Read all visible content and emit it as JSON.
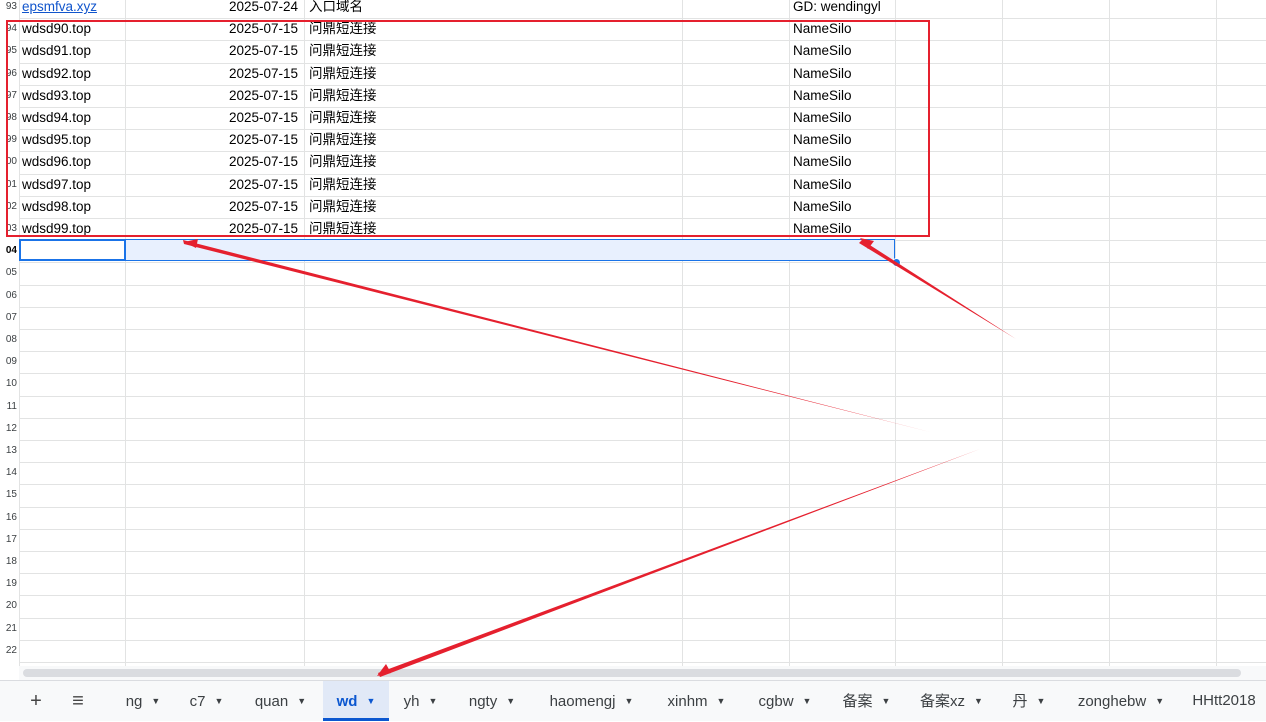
{
  "rows": [
    {
      "num": "93",
      "domain": "epsmfva.xyz",
      "date": "2025-07-24",
      "desc": "入口域名",
      "registrar": "GD: wendingyl",
      "link": true
    },
    {
      "num": "94",
      "domain": "wdsd90.top",
      "date": "2025-07-15",
      "desc": "问鼎短连接",
      "registrar": "NameSilo"
    },
    {
      "num": "95",
      "domain": "wdsd91.top",
      "date": "2025-07-15",
      "desc": "问鼎短连接",
      "registrar": "NameSilo"
    },
    {
      "num": "96",
      "domain": "wdsd92.top",
      "date": "2025-07-15",
      "desc": "问鼎短连接",
      "registrar": "NameSilo"
    },
    {
      "num": "97",
      "domain": "wdsd93.top",
      "date": "2025-07-15",
      "desc": "问鼎短连接",
      "registrar": "NameSilo"
    },
    {
      "num": "98",
      "domain": "wdsd94.top",
      "date": "2025-07-15",
      "desc": "问鼎短连接",
      "registrar": "NameSilo"
    },
    {
      "num": "99",
      "domain": "wdsd95.top",
      "date": "2025-07-15",
      "desc": "问鼎短连接",
      "registrar": "NameSilo"
    },
    {
      "num": "00",
      "domain": "wdsd96.top",
      "date": "2025-07-15",
      "desc": "问鼎短连接",
      "registrar": "NameSilo"
    },
    {
      "num": "01",
      "domain": "wdsd97.top",
      "date": "2025-07-15",
      "desc": "问鼎短连接",
      "registrar": "NameSilo"
    },
    {
      "num": "02",
      "domain": "wdsd98.top",
      "date": "2025-07-15",
      "desc": "问鼎短连接",
      "registrar": "NameSilo"
    },
    {
      "num": "03",
      "domain": "wdsd99.top",
      "date": "2025-07-15",
      "desc": "问鼎短连接",
      "registrar": "NameSilo"
    }
  ],
  "empty_rows": [
    "04",
    "05",
    "06",
    "07",
    "08",
    "09",
    "10",
    "11",
    "12",
    "13",
    "14",
    "15",
    "16",
    "17",
    "18",
    "19",
    "20",
    "21",
    "22"
  ],
  "selected_row": "04",
  "tab_controls": {
    "add": "+",
    "all_sheets": "≡"
  },
  "tabs": [
    {
      "label": "ng"
    },
    {
      "label": "c7"
    },
    {
      "label": "quan"
    },
    {
      "label": "wd",
      "active": true
    },
    {
      "label": "yh"
    },
    {
      "label": "ngty"
    },
    {
      "label": "haomengj"
    },
    {
      "label": "xinhm"
    },
    {
      "label": "cgbw"
    },
    {
      "label": "备案"
    },
    {
      "label": "备案xz"
    },
    {
      "label": "丹"
    },
    {
      "label": "zonghebw"
    },
    {
      "label": "HHtt2018"
    }
  ],
  "colors": {
    "annotation": "#e5202e",
    "selection": "#1a73e8",
    "link": "#1155cc"
  }
}
